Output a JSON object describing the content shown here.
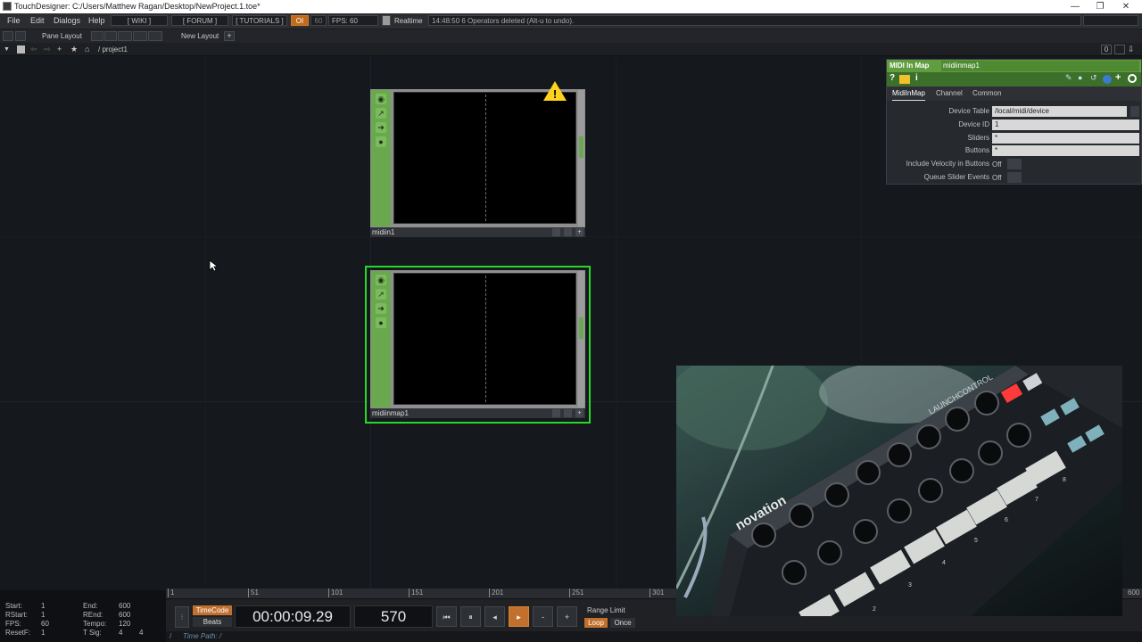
{
  "window": {
    "title": "TouchDesigner: C:/Users/Matthew Ragan/Desktop/NewProject.1.toe*",
    "controls": [
      "—",
      "❐",
      "✕"
    ]
  },
  "menubar": {
    "items": [
      "File",
      "Edit",
      "Dialogs",
      "Help"
    ],
    "wiki": "[ WIKI ]",
    "forum": "[ FORUM ]",
    "tutorials": "[ TUTORIALS ]",
    "oi": "OI",
    "sixty": "60",
    "fps": "FPS: 60",
    "realtime": "Realtime",
    "message": "14:48:50 6 Operators deleted (Alt-u to undo)."
  },
  "toolbar": {
    "pane_layout": "Pane Layout",
    "new_layout": "New Layout",
    "plus": "+"
  },
  "pathbar": {
    "path": "/ project1",
    "right_zero": "0"
  },
  "nodes": [
    {
      "name": "midiin1"
    },
    {
      "name": "midiinmap1"
    }
  ],
  "param": {
    "op_type": "MIDI In Map",
    "op_name": "midiinmap1",
    "help_icons": [
      "?",
      "i"
    ],
    "tabs": [
      "MidiInMap",
      "Channel",
      "Common"
    ],
    "rows": [
      {
        "label": "Device Table",
        "value": "/local/midi/device"
      },
      {
        "label": "Device ID",
        "value": "1"
      },
      {
        "label": "Sliders",
        "value": "*"
      },
      {
        "label": "Buttons",
        "value": "*"
      },
      {
        "label": "Include Velocity in Buttons",
        "value": "Off"
      },
      {
        "label": "Queue Slider Events",
        "value": "Off"
      }
    ]
  },
  "timeline": {
    "ticks": [
      "1",
      "51",
      "101",
      "151",
      "201",
      "251",
      "301"
    ],
    "end_tick": "600"
  },
  "status": {
    "start_label": "Start:",
    "start": "1",
    "end_label": "End:",
    "end": "600",
    "rstart_label": "RStart:",
    "rstart": "1",
    "rend_label": "REnd:",
    "rend": "600",
    "fps_label": "FPS:",
    "fps": "60",
    "tempo_label": "Tempo:",
    "tempo": "120",
    "resetf_label": "ResetF:",
    "resetf": "1",
    "tsig_label": "T Sig:",
    "tsig_a": "4",
    "tsig_b": "4"
  },
  "transport": {
    "timecode_label": "TimeCode",
    "beats_label": "Beats",
    "timecode": "00:00:09.29",
    "frame": "570",
    "range_limit": "Range Limit",
    "loop": "Loop",
    "once": "Once",
    "time_path": "Time Path: /",
    "minus": "-",
    "plus": "+"
  },
  "photo": {
    "brand": "novation",
    "device": "LAUNCHCONTROL",
    "pad_numbers": [
      "2",
      "3",
      "4",
      "5",
      "6",
      "7",
      "8"
    ]
  },
  "colors": {
    "comp_green": "#6aa84f",
    "selection": "#27d927",
    "warning": "#ffd21e",
    "accent_orange": "#c2702d"
  }
}
